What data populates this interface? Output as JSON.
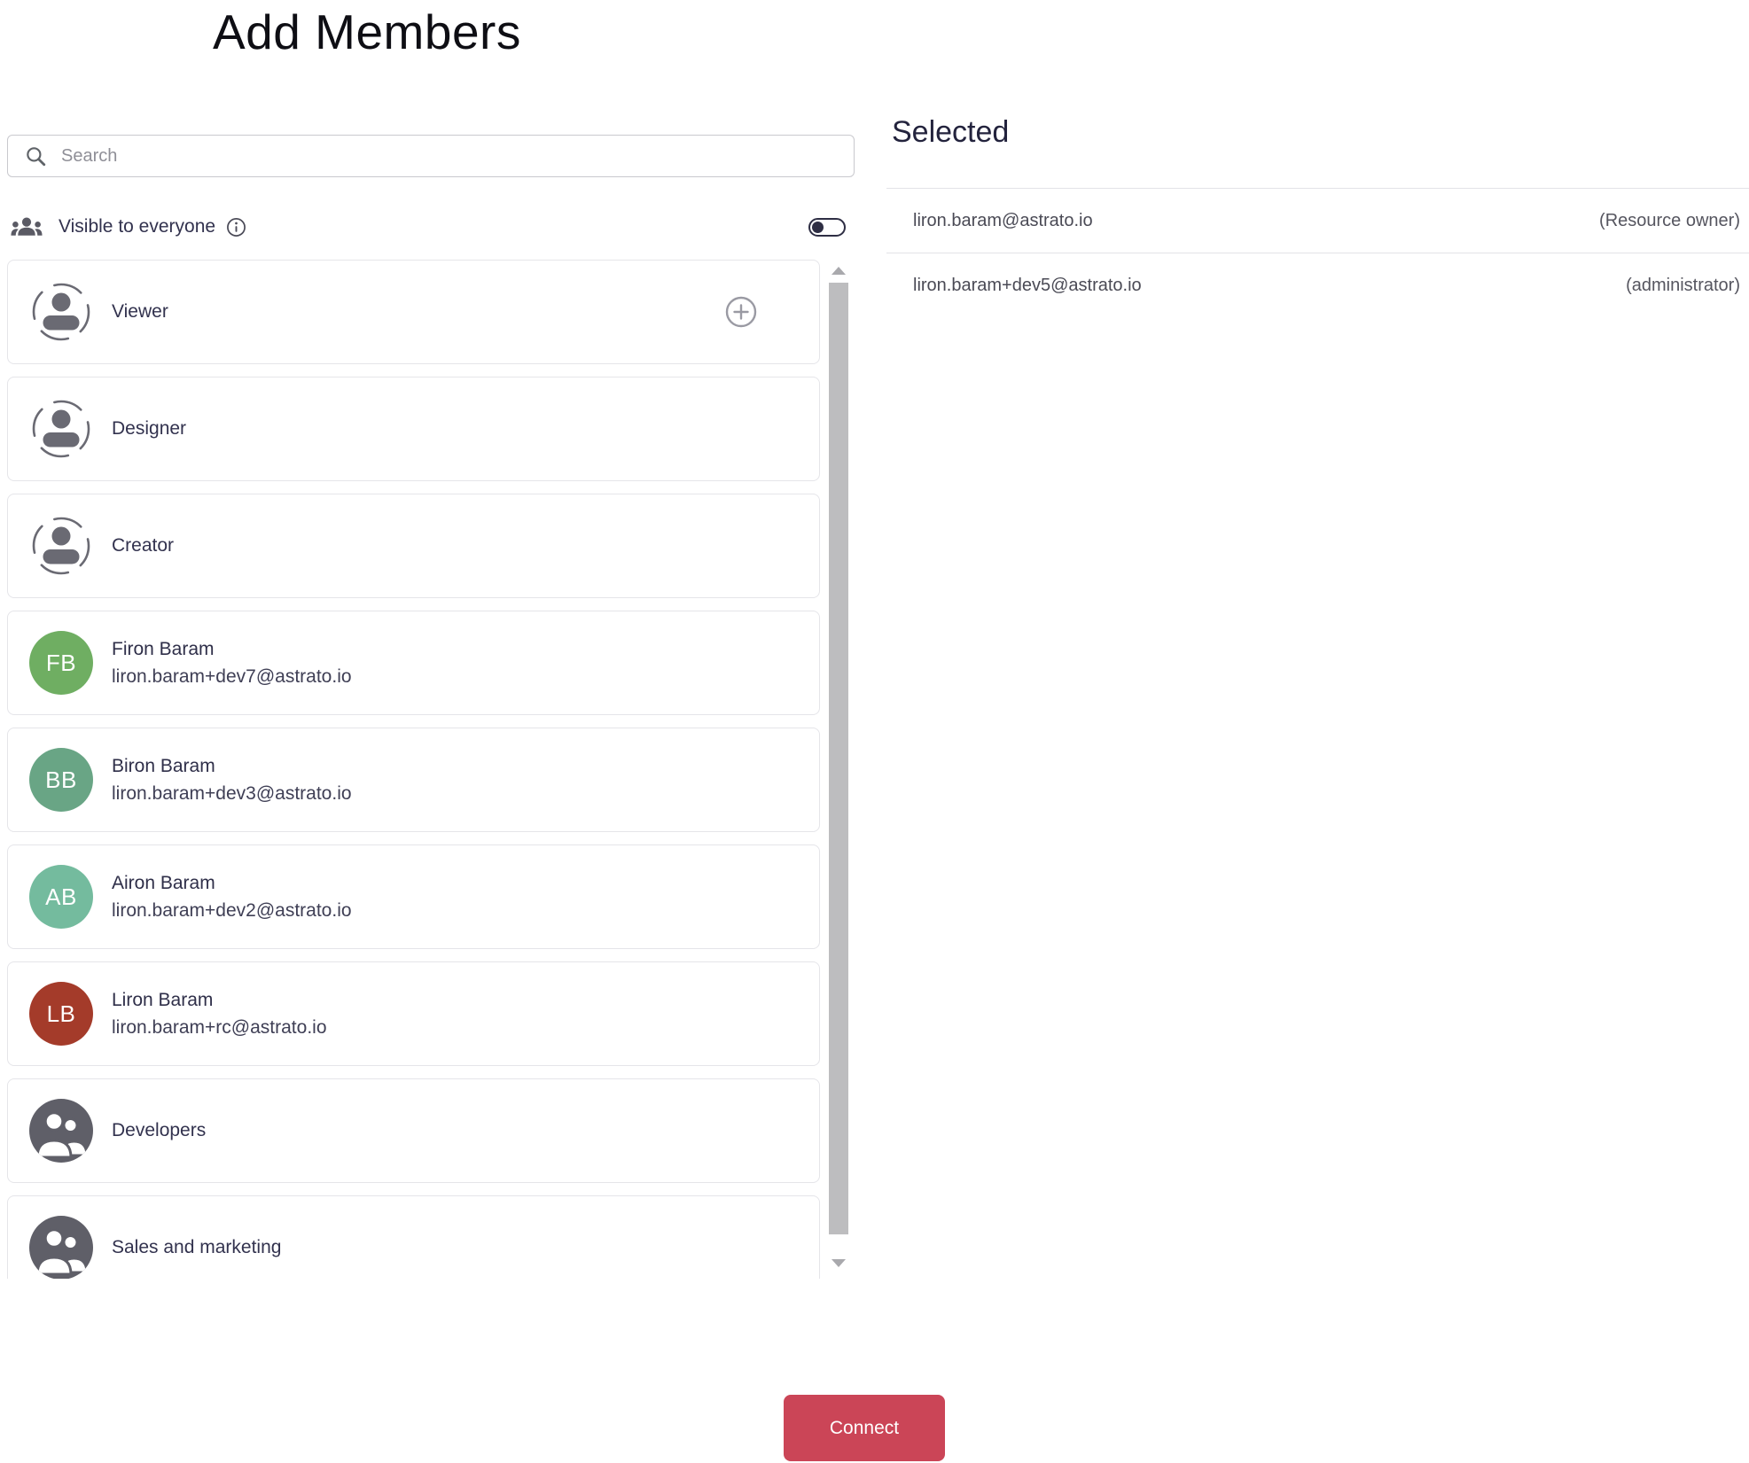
{
  "page": {
    "title": "Add Members"
  },
  "search": {
    "placeholder": "Search",
    "value": ""
  },
  "visibility": {
    "label": "Visible to everyone",
    "toggle_on": false
  },
  "list": [
    {
      "type": "role",
      "label": "Viewer",
      "has_add": true
    },
    {
      "type": "role",
      "label": "Designer"
    },
    {
      "type": "role",
      "label": "Creator"
    },
    {
      "type": "user",
      "name": "Firon Baram",
      "email": "liron.baram+dev7@astrato.io",
      "initials": "FB",
      "color": "#6fae62"
    },
    {
      "type": "user",
      "name": "Biron Baram",
      "email": "liron.baram+dev3@astrato.io",
      "initials": "BB",
      "color": "#69a585"
    },
    {
      "type": "user",
      "name": "Airon Baram",
      "email": "liron.baram+dev2@astrato.io",
      "initials": "AB",
      "color": "#74bb9e"
    },
    {
      "type": "user",
      "name": "Liron Baram",
      "email": "liron.baram+rc@astrato.io",
      "initials": "LB",
      "color": "#a43b2a"
    },
    {
      "type": "group",
      "label": "Developers"
    },
    {
      "type": "group",
      "label": "Sales and marketing"
    }
  ],
  "selected": {
    "title": "Selected",
    "rows": [
      {
        "email": "liron.baram@astrato.io",
        "role": "(Resource owner)"
      },
      {
        "email": "liron.baram+dev5@astrato.io",
        "role": "(administrator)"
      }
    ]
  },
  "footer": {
    "connect_label": "Connect"
  },
  "colors": {
    "accent": "#cb4557",
    "toggle": "#2e2e44",
    "icon_gray": "#6a6a73",
    "group_circle": "#5f5f68",
    "scroll_thumb": "#bdbdbf",
    "card_border": "#e5e5e9"
  }
}
